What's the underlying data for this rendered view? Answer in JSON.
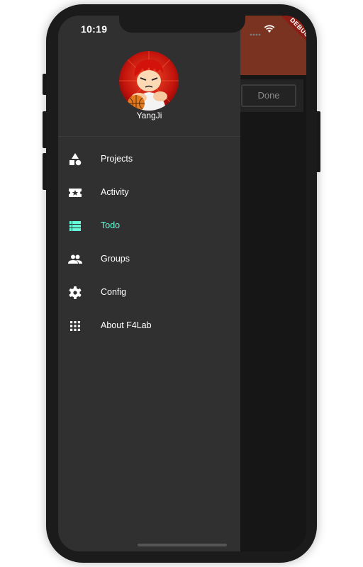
{
  "status_bar": {
    "time": "10:19"
  },
  "debug_banner": "DEBUG",
  "background_app": {
    "done_label": "Done"
  },
  "drawer": {
    "user_name": "YangJi",
    "items": [
      {
        "label": "Projects",
        "icon": "shapes-icon",
        "active": false
      },
      {
        "label": "Activity",
        "icon": "ticket-star-icon",
        "active": false
      },
      {
        "label": "Todo",
        "icon": "list-icon",
        "active": true
      },
      {
        "label": "Groups",
        "icon": "people-icon",
        "active": false
      },
      {
        "label": "Config",
        "icon": "gear-icon",
        "active": false
      },
      {
        "label": "About F4Lab",
        "icon": "apps-grid-icon",
        "active": false
      }
    ]
  },
  "colors": {
    "drawer_bg": "#303030",
    "accent": "#64ffda",
    "appbar": "#7a3320",
    "debug_ribbon": "#8b1d14"
  }
}
